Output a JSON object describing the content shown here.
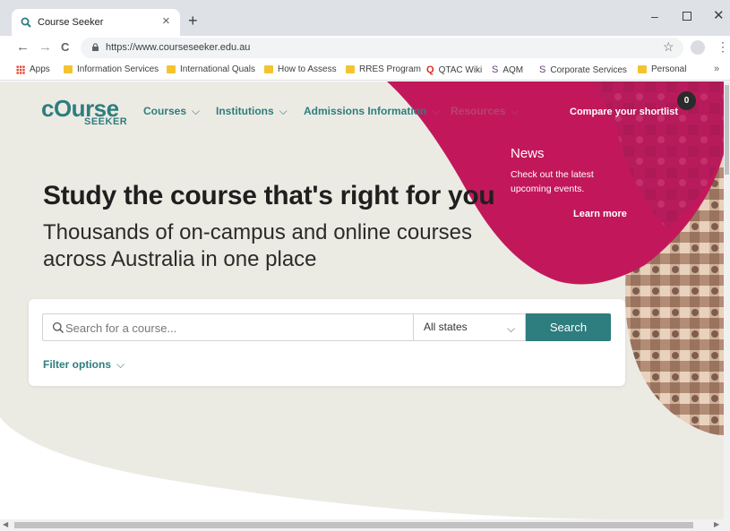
{
  "browser": {
    "tab_title": "Course Seeker",
    "tab_close": "×",
    "new_tab": "+",
    "url": "https://www.courseseeker.edu.au",
    "window_controls": {
      "minimize": "–",
      "close": "✕"
    },
    "nav": {
      "back": "←",
      "forward": "→",
      "reload": "C"
    },
    "star": "☆",
    "menu": "⋮",
    "bookmarks": [
      {
        "label": "Apps",
        "icon": "apps-grid-icon"
      },
      {
        "label": "Information Services",
        "icon": "folder-icon"
      },
      {
        "label": "International Quals",
        "icon": "folder-icon"
      },
      {
        "label": "How to Assess",
        "icon": "folder-icon"
      },
      {
        "label": "RRES Program",
        "icon": "folder-icon"
      },
      {
        "label": "QTAC Wiki",
        "icon": "qtac-icon"
      },
      {
        "label": "AQM",
        "icon": "link-icon"
      },
      {
        "label": "Corporate Services",
        "icon": "link-icon"
      },
      {
        "label": "Personal",
        "icon": "folder-icon"
      }
    ],
    "bookmarks_more": "»"
  },
  "site": {
    "logo_main": "cOurse",
    "logo_sub": "SEEKER",
    "nav": [
      {
        "label": "Courses"
      },
      {
        "label": "Institutions"
      },
      {
        "label": "Admissions Information"
      },
      {
        "label": "Resources"
      }
    ],
    "shortlist_label": "Compare your shortlist",
    "shortlist_count": "0",
    "news": {
      "title": "News",
      "body": "Check out the latest upcoming events.",
      "link": "Learn more"
    },
    "hero_title": "Study the course that's right for you",
    "hero_subtitle": "Thousands of on-campus and online courses across Australia in one place",
    "search": {
      "placeholder": "Search for a course...",
      "state_value": "All states",
      "button": "Search",
      "filter": "Filter options"
    }
  },
  "colors": {
    "brand_teal": "#2e7d7f",
    "brand_magenta": "#c2185b",
    "hero_bg": "#ecebe3"
  }
}
